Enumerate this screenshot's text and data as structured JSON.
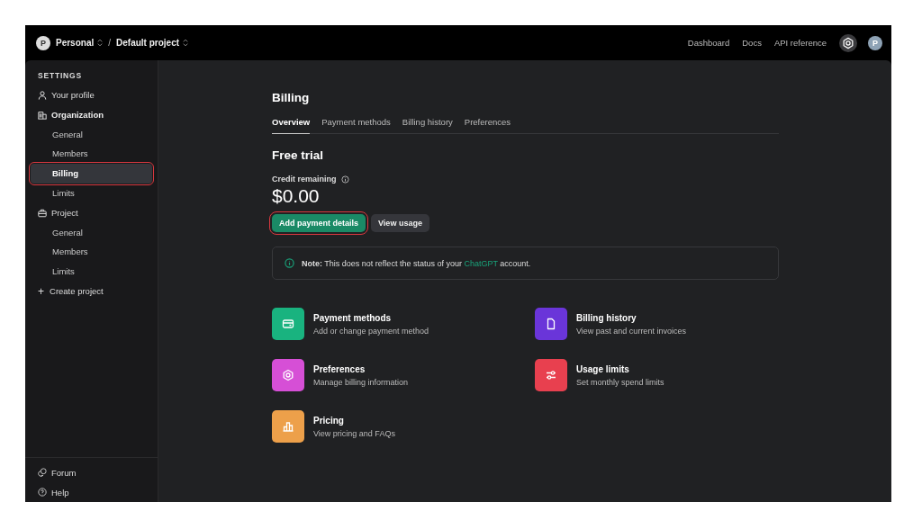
{
  "topbar": {
    "avatar": "P",
    "org": "Personal",
    "separator": "/",
    "project": "Default project",
    "links": [
      "Dashboard",
      "Docs",
      "API reference"
    ],
    "user_avatar": "P"
  },
  "sidebar": {
    "heading": "SETTINGS",
    "items": [
      {
        "label": "Your profile",
        "bold": false
      },
      {
        "label": "Organization",
        "bold": true,
        "children": [
          {
            "label": "General",
            "selected": false,
            "annotated": false
          },
          {
            "label": "Members",
            "selected": false,
            "annotated": false
          },
          {
            "label": "Billing",
            "selected": true,
            "annotated": true
          },
          {
            "label": "Limits",
            "selected": false,
            "annotated": false
          }
        ]
      },
      {
        "label": "Project",
        "bold": false,
        "children": [
          {
            "label": "General",
            "selected": false,
            "annotated": false
          },
          {
            "label": "Members",
            "selected": false,
            "annotated": false
          },
          {
            "label": "Limits",
            "selected": false,
            "annotated": false
          }
        ]
      }
    ],
    "create": {
      "icon": "+",
      "label": "Create project"
    },
    "footer": [
      "Forum",
      "Help"
    ]
  },
  "page": {
    "title": "Billing",
    "tabs": [
      {
        "label": "Overview",
        "selected": true
      },
      {
        "label": "Payment methods",
        "selected": false
      },
      {
        "label": "Billing history",
        "selected": false
      },
      {
        "label": "Preferences",
        "selected": false
      }
    ],
    "section": "Free trial",
    "credit_label": "Credit remaining",
    "credit": "$0.00",
    "buttons": [
      {
        "label": "Add payment details",
        "kind": "primary",
        "annotated": true
      },
      {
        "label": "View usage",
        "kind": "secondary",
        "annotated": false
      }
    ],
    "note": "**Note:** This does not reflect the status of your",
    "note_link": "ChatGPT",
    "note_end": "account.",
    "cards": [
      {
        "title": "Payment methods",
        "subtitle": "Add or change payment method",
        "color": "#19b37f"
      },
      {
        "title": "Billing history",
        "subtitle": "View past and current invoices",
        "color": "#6a35d9"
      },
      {
        "title": "Preferences",
        "subtitle": "Manage billing information",
        "color": "#d64fd6"
      },
      {
        "title": "Usage limits",
        "subtitle": "Set monthly spend limits",
        "color": "#e8404f"
      },
      {
        "title": "Pricing",
        "subtitle": "View pricing and FAQs",
        "color": "#eda04a"
      }
    ]
  }
}
